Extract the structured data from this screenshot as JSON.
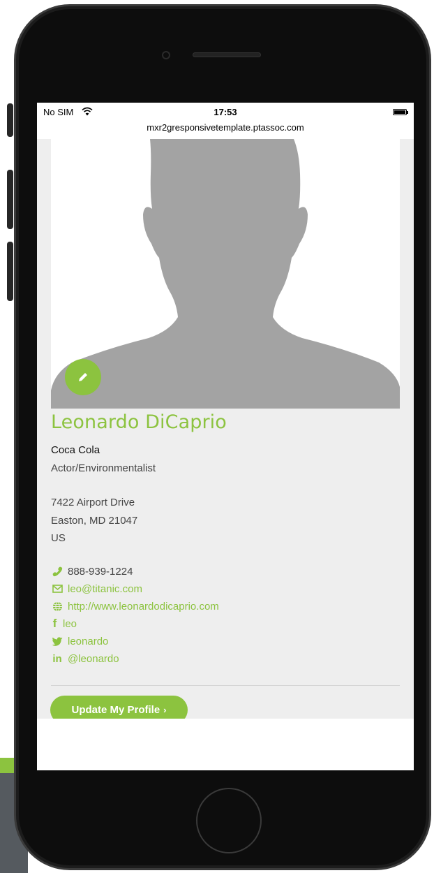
{
  "status_bar": {
    "carrier": "No SIM",
    "time": "17:53",
    "url": "mxr2gresponsivetemplate.ptassoc.com"
  },
  "profile": {
    "name": "Leonardo DiCaprio",
    "company": "Coca Cola",
    "job_title": "Actor/Environmentalist",
    "address": {
      "line1": "7422 Airport Drive",
      "line2": "Easton, MD 21047",
      "line3": "US"
    },
    "contacts": {
      "phone": "888-939-1224",
      "email": "leo@titanic.com",
      "website": "http://www.leonardodicaprio.com",
      "facebook": "leo",
      "twitter": "leonardo",
      "linkedin": "@leonardo"
    }
  },
  "actions": {
    "update_label": "Update My Profile",
    "update_chevron": "›"
  },
  "icons": {
    "edit": "pencil-icon",
    "phone": "phone-icon",
    "email": "envelope-icon",
    "website": "globe-icon",
    "facebook": "facebook-icon",
    "twitter": "twitter-icon",
    "linkedin": "linkedin-icon"
  },
  "colors": {
    "accent": "#8cc33f",
    "panel_bg": "#eeeeee",
    "silhouette": "#a3a3a3"
  }
}
